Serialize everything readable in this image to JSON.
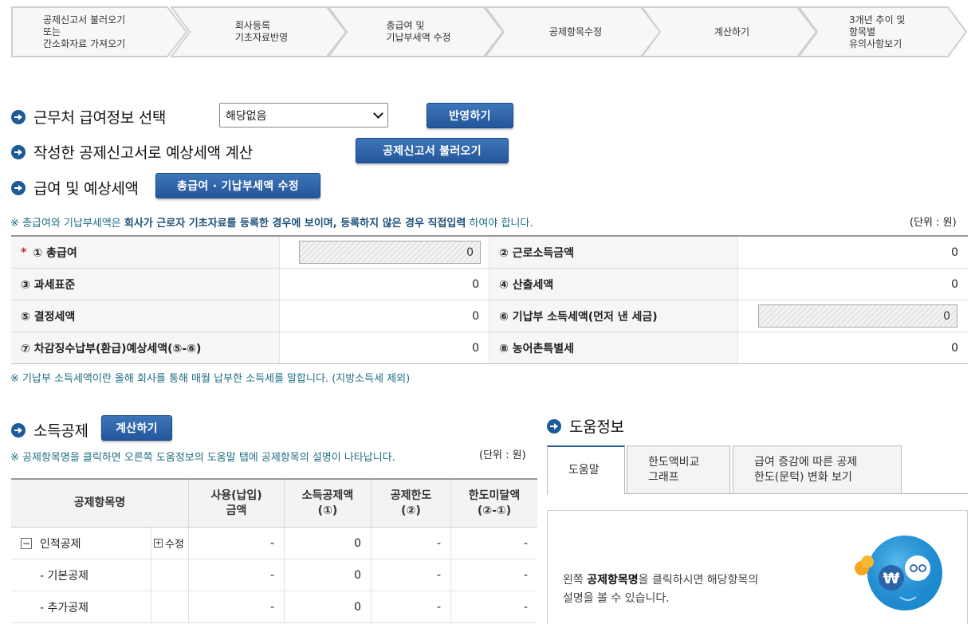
{
  "steps": [
    {
      "label": "공제신고서 불러오기\n또는\n간소화자료 가져오기"
    },
    {
      "label": "회사등록\n기초자료반영"
    },
    {
      "label": "총급여 및\n기납부세액 수정"
    },
    {
      "label": "공제항목수정"
    },
    {
      "label": "계산하기"
    },
    {
      "label": "3개년 추이 및\n항목별\n유의사항보기"
    }
  ],
  "sections": {
    "workplace": {
      "title": "근무처 급여정보 선택",
      "select_value": "해당없음",
      "apply_button": "반영하기"
    },
    "estimate": {
      "title": "작성한 공제신고서로 예상세액 계산",
      "load_button": "공제신고서 불러오기"
    },
    "salary": {
      "title": "급여 및 예상세액",
      "edit_button": "총급여 · 기납부세액 수정"
    }
  },
  "salary_note": {
    "prefix": "※ 총급여와 기납부세액은",
    "bold": "회사가 근로자 기초자료를 등록한 경우에 보이며, 등록하지 않은 경우 직접입력",
    "suffix": "하여야 합니다."
  },
  "unit_label": "(단위 : 원)",
  "salary_table": [
    {
      "l_label": "① 총급여",
      "l_value": "0",
      "r_label": "② 근로소득금액",
      "r_value": "0"
    },
    {
      "l_label": "③ 과세표준",
      "l_value": "0",
      "r_label": "④ 산출세액",
      "r_value": "0"
    },
    {
      "l_label": "⑤ 결정세액",
      "l_value": "0",
      "r_label": "⑥ 기납부 소득세액(먼저 낸 세금)",
      "r_value": "0"
    },
    {
      "l_label": "⑦ 차감징수납부(환급)예상세액(⑤-⑥)",
      "l_value": "0",
      "r_label": "⑧ 농어촌특별세",
      "r_value": "0"
    }
  ],
  "required_mark": "*",
  "prepaid_note": "※ 기납부 소득세액이란 올해 회사를 통해 매월 납부한 소득세를 말합니다. (지방소득세 제외)",
  "income_deduction": {
    "title": "소득공제",
    "calc_button": "계산하기",
    "note": "※ 공제항목명을 클릭하면 오른쪽 도움정보의 도움말 탭에 공제항목의 설명이 나타납니다.",
    "headers": [
      "공제항목명",
      "사용(납입)\n금액",
      "소득공제액\n(①)",
      "공제한도\n(②)",
      "한도미달액\n(②-①)"
    ],
    "rows": [
      {
        "name": "인적공제",
        "toggle": "−",
        "edit": "수정",
        "edit_symbol": "+",
        "used": "-",
        "deduction": "0",
        "limit": "-",
        "short": "-"
      },
      {
        "name": "- 기본공제",
        "used": "-",
        "deduction": "0",
        "limit": "-",
        "short": "-"
      },
      {
        "name": "- 추가공제",
        "used": "-",
        "deduction": "0",
        "limit": "-",
        "short": "-"
      }
    ]
  },
  "help": {
    "title": "도움정보",
    "tabs": [
      {
        "label": "도움말"
      },
      {
        "label": "한도액비교\n그래프"
      },
      {
        "label": "급여 증감에 따른 공제\n한도(문턱) 변화 보기"
      }
    ],
    "text_line1_prefix": "왼쪽",
    "text_line1_bold": "공제항목명",
    "text_line1_suffix": "을 클릭하시면 해당항목의",
    "text_line2": "설명을 볼 수 있습니다.",
    "mascot_symbol": "₩"
  },
  "colors": {
    "accent": "#1d5a97",
    "button": "#2a5f9f",
    "teal": "#1e6d86"
  }
}
